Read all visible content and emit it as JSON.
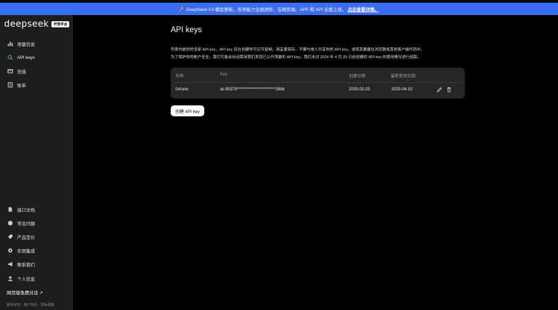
{
  "banner": {
    "icon": "rocket-icon",
    "text": "DeepSeek-V3 模型更新，各项能力全面进阶，在网页端、APP 和 API 全面上线，",
    "link": "点击查看详情。",
    "color": "#3b6cf6"
  },
  "sidebar": {
    "logo_text": "deepseek",
    "logo_badge": "开放平台",
    "top_items": [
      {
        "label": "用量信息",
        "icon": "bar-chart-icon"
      },
      {
        "label": "API keys",
        "icon": "search-icon",
        "active": true,
        "active_color": "#4fb06d"
      },
      {
        "label": "充值",
        "icon": "wallet-icon"
      },
      {
        "label": "账单",
        "icon": "bill-icon"
      }
    ],
    "bottom_items": [
      {
        "label": "接口文档",
        "icon": "document-icon"
      },
      {
        "label": "常见问题",
        "icon": "help-icon"
      },
      {
        "label": "产品定价",
        "icon": "tag-icon"
      },
      {
        "label": "实用集成",
        "icon": "gear-icon"
      },
      {
        "label": "联系我们",
        "icon": "megaphone-icon"
      },
      {
        "label": "个人信息",
        "icon": "user-icon"
      }
    ],
    "web_chat": "网页版免费对话 ↗",
    "footer": [
      "服务状态",
      "用户协议",
      "隐私政策"
    ]
  },
  "main": {
    "title": "API keys",
    "description_line1": "列表内是你的全部 API key，API key 仅在创建时可见可复制，请妥善保存。不要与他人共享你的 API key，或将其暴露在浏览器或其他客户端代码中。",
    "description_line2": "为了保护你的帐户安全，我们可能会自动禁用我们发现已公开泄露的 API key。我们未对 2024 年 4 月 25 日前创建的 API key 的使用情况进行追踪。",
    "table": {
      "headers": [
        "名称",
        "Key",
        "创建日期",
        "最新使用日期"
      ],
      "rows": [
        {
          "name": "fortune",
          "key": "sk-95379************************28bb",
          "created": "2025-02-25",
          "last_used": "2025-04-10"
        }
      ]
    },
    "create_button": "创建 API key"
  }
}
